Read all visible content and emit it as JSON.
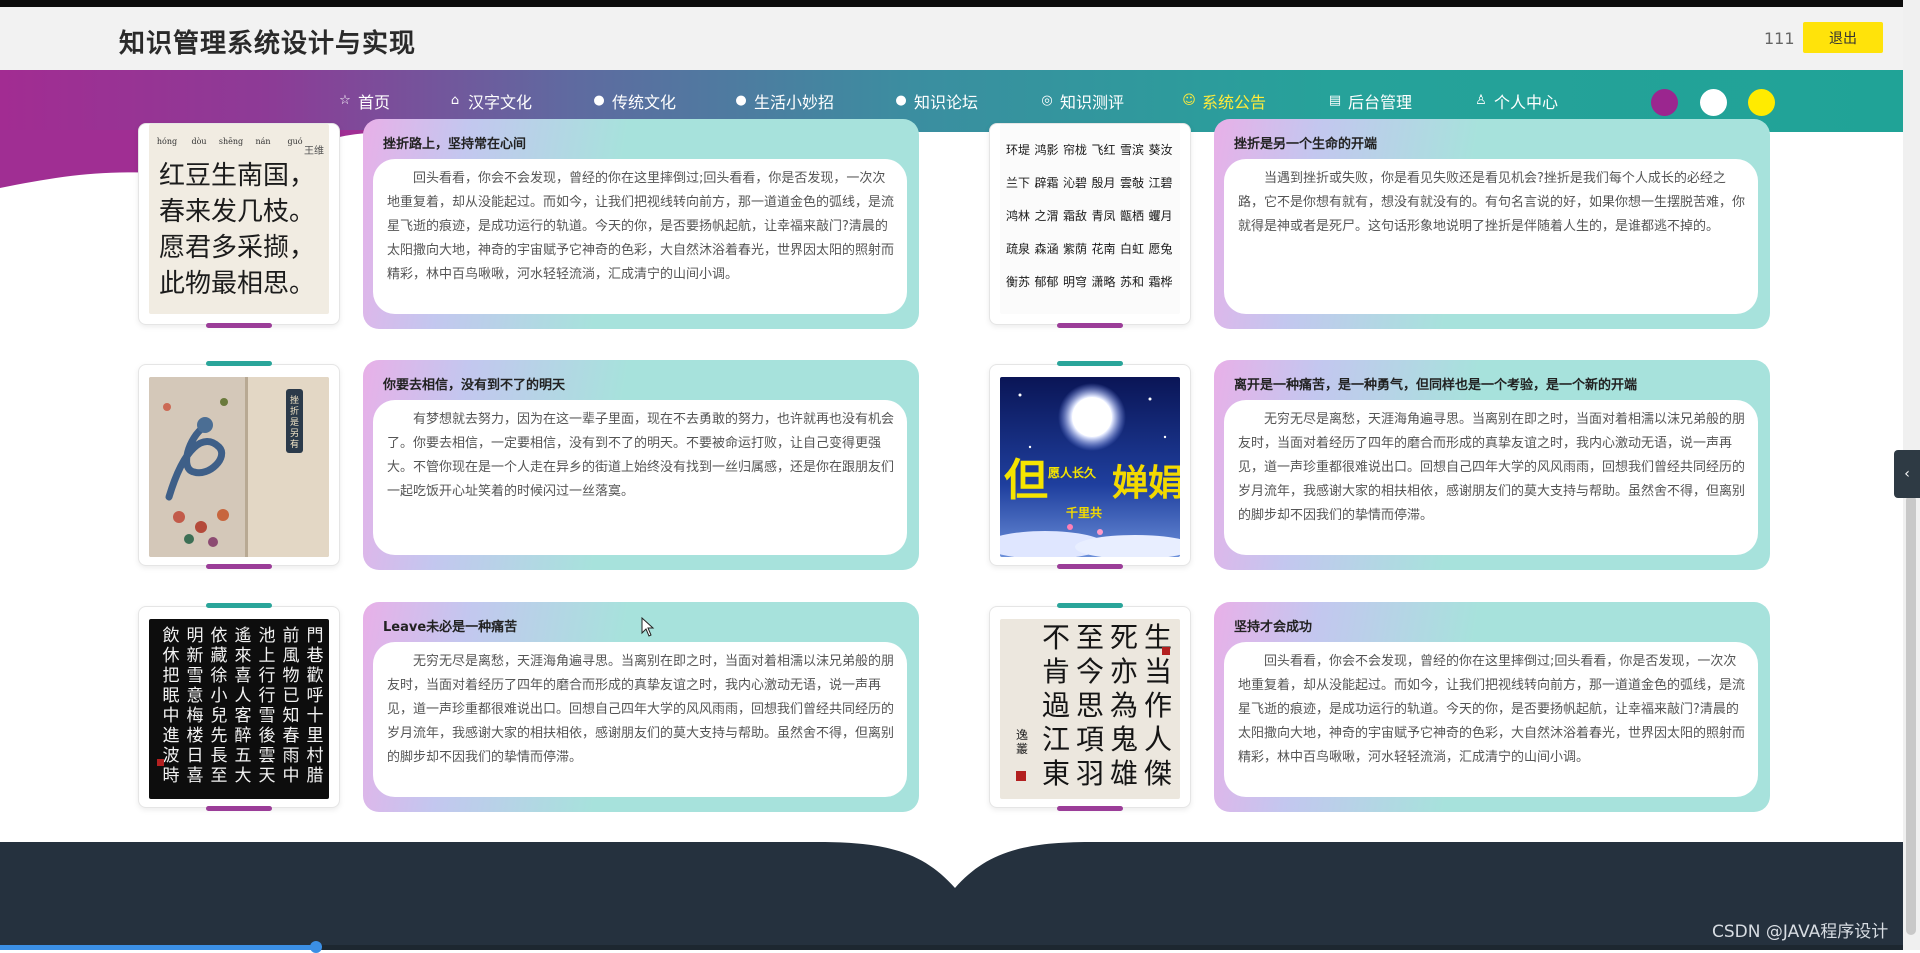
{
  "header": {
    "title": "知识管理系统设计与实现",
    "user": "111",
    "logout": "退出"
  },
  "nav": {
    "items": [
      {
        "icon": "☆",
        "label": "首页"
      },
      {
        "icon": "⌂",
        "label": "汉字文化"
      },
      {
        "icon": "●",
        "label": "传统文化"
      },
      {
        "icon": "●",
        "label": "生活小妙招"
      },
      {
        "icon": "●",
        "label": "知识论坛"
      },
      {
        "icon": "◎",
        "label": "知识测评"
      },
      {
        "icon": "☺",
        "label": "系统公告",
        "active": true
      },
      {
        "icon": "▤",
        "label": "后台管理"
      },
      {
        "icon": "♙",
        "label": "个人中心"
      }
    ],
    "theme_colors": [
      "#9b268f",
      "#ffffff",
      "#ffeb00"
    ]
  },
  "poem_red_beans": {
    "pinyin": [
      "hóng",
      "dòu",
      "shēng",
      "nán",
      "guó"
    ],
    "lines": [
      "红豆生南国，",
      "春来发几枝。",
      "愿君多采撷，",
      "此物最相思。"
    ],
    "author": "王维"
  },
  "poem_grid": [
    [
      "环堤",
      "鸿影",
      "帘栊",
      "飞红",
      "雪滨",
      "葵汝"
    ],
    [
      "兰下",
      "辟霜",
      "沁碧",
      "殷月",
      "雲敧",
      "江碧"
    ],
    [
      "鸿林",
      "之渭",
      "霜敌",
      "青凤",
      "甑栖",
      "蠼月"
    ],
    [
      "疏泉",
      "森涵",
      "紫荫",
      "花南",
      "白虹",
      "愿兔"
    ],
    [
      "衡苏",
      "郁郁",
      "明穹",
      "潇略",
      "苏和",
      "霜桦"
    ]
  ],
  "vertical_sign": "挫折是另有",
  "mid_autumn_text": {
    "left": "但愿人长久",
    "right": "千里共婵娟"
  },
  "items": [
    {
      "title": "挫折路上，坚持常在心间",
      "text": "回头看看，你会不会发现，曾经的你在这里摔倒过;回头看看，你是否发现，一次次地重复着，却从没能起过。而如今，让我们把视线转向前方，那一道道金色的弧线，是流星飞逝的痕迹，是成功运行的轨道。今天的你，是否要扬帆起航，让幸福来敲门?清晨的太阳撒向大地，神奇的宇宙赋予它神奇的色彩，大自然沐浴着春光，世界因太阳的照射而精彩，林中百鸟啾啾，河水轻轻流淌，汇成清宁的山间小调。"
    },
    {
      "title": "挫折是另一个生命的开端",
      "text": "当遇到挫折或失败，你是看见失败还是看见机会?挫折是我们每个人成长的必经之路，它不是你想有就有，想没有就没有的。有句名言说的好，如果你想一生摆脱苦难，你就得是神或者是死尸。这句话形象地说明了挫折是伴随着人生的，是谁都逃不掉的。"
    },
    {
      "title": "你要去相信，没有到不了的明天",
      "text": "有梦想就去努力，因为在这一辈子里面，现在不去勇敢的努力，也许就再也没有机会了。你要去相信，一定要相信，没有到不了的明天。不要被命运打败，让自己变得更强大。不管你现在是一个人走在异乡的街道上始终没有找到一丝归属感，还是你在跟朋友们一起吃饭开心址笑着的时候闪过一丝落寞。"
    },
    {
      "title": "离开是一种痛苦，是一种勇气，但同样也是一个考验，是一个新的开端",
      "text": "无穷无尽是离愁，天涯海角遍寻思。当离别在即之时，当面对着相濡以沫兄弟般的朋友时，当面对着经历了四年的磨合而形成的真挚友谊之时，我内心激动无语，说一声再见，道一声珍重都很难说出口。回想自己四年大学的风风雨雨，回想我们曾经共同经历的岁月流年，我感谢大家的相扶相依，感谢朋友们的莫大支持与帮助。虽然舍不得，但离别的脚步却不因我们的挚情而停滞。"
    },
    {
      "title": "Leave未必是一种痛苦",
      "text": "无穷无尽是离愁，天涯海角遍寻思。当离别在即之时，当面对着相濡以沫兄弟般的朋友时，当面对着经历了四年的磨合而形成的真挚友谊之时，我内心激动无语，说一声再见，道一声珍重都很难说出口。回想自己四年大学的风风雨雨，回想我们曾经共同经历的岁月流年，我感谢大家的相扶相依，感谢朋友们的莫大支持与帮助。虽然舍不得，但离别的脚步却不因我们的挚情而停滞。"
    },
    {
      "title": "坚持才会成功",
      "text": "回头看看，你会不会发现，曾经的你在这里摔倒过;回头看看，你是否发现，一次次地重复着，却从没能起过。而如今，让我们把视线转向前方，那一道道金色的弧线，是流星飞逝的痕迹，是成功运行的轨道。今天的你，是否要扬帆起航，让幸福来敲门?清晨的太阳撒向大地，神奇的宇宙赋予它神奇的色彩，大自然沐浴着春光，世界因太阳的照射而精彩，林中百鸟啾啾，河水轻轻流淌，汇成清宁的山间小调。"
    }
  ],
  "calligraphy_right": [
    [
      "生",
      "当",
      "作",
      "人",
      "傑"
    ],
    [
      "死",
      "亦",
      "為",
      "鬼",
      "雄"
    ],
    [
      "至",
      "今",
      "思",
      "項",
      "羽"
    ],
    [
      "不",
      "肯",
      "過",
      "江",
      "東"
    ]
  ],
  "calligraphy_right_signature": "逸叢",
  "calligraphy_left": [
    [
      "門",
      "巷",
      "歡",
      "呼",
      "十",
      "里",
      "村",
      "腊"
    ],
    [
      "前",
      "風",
      "物",
      "已",
      "知",
      "春",
      "雨",
      "中"
    ],
    [
      "池",
      "上",
      "行",
      "行",
      "雪",
      "後",
      "雲",
      "天"
    ],
    [
      "遙",
      "來",
      "喜",
      "人",
      "客",
      "醉",
      "五",
      "大"
    ],
    [
      "依",
      "藏",
      "徐",
      "小",
      "兒",
      "先",
      "長",
      "至"
    ],
    [
      "明",
      "新",
      "雪",
      "意",
      "梅",
      "楼",
      "日",
      "喜"
    ],
    [
      "飲",
      "休",
      "把",
      "眠",
      "中",
      "進",
      "波",
      "時"
    ]
  ],
  "footer": {
    "watermark": "CSDN @JAVA程序设计"
  }
}
